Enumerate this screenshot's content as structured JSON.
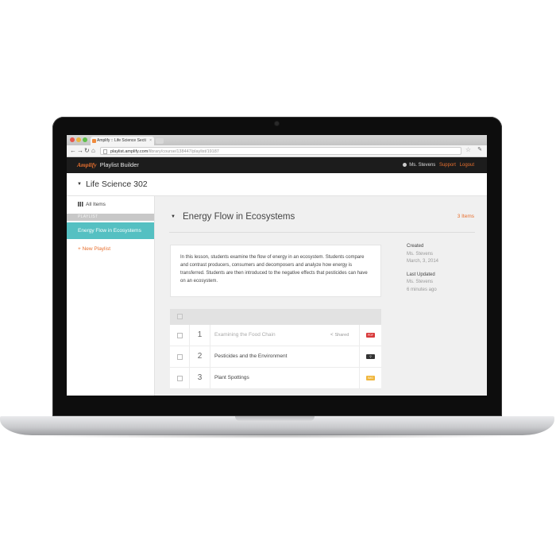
{
  "browser": {
    "tab_title": "Amplify :: Life Science Secti",
    "url_host": "playlist.amplify.com",
    "url_path": "/library/course/138447/playlist/19187"
  },
  "app": {
    "brand": "Amplify",
    "product": "Playlist Builder",
    "user_name": "Ms. Stevens",
    "support_label": "Support",
    "logout_label": "Logout"
  },
  "course": {
    "title": "Life Science 302"
  },
  "sidebar": {
    "all_items_label": "All Items",
    "section_label": "PLAYLIST",
    "active_playlist": "Energy Flow in Ecosystems",
    "new_playlist_label": "+ New Playlist"
  },
  "playlist": {
    "title": "Energy Flow in Ecosystems",
    "item_count": "3 Items",
    "description": "In this lesson, students examine the flow of energy in an ecosystem. Students compare and contrast producers, consumers and decomposers and analyze how energy is transferred. Students are then  introduced to the negative effects that pesticides can have on an ecosystem.",
    "created_label": "Created",
    "created_by": "Ms. Stevens",
    "created_date": "March, 3, 2014",
    "updated_label": "Last Updated",
    "updated_by": "Ms. Stevens",
    "updated_time": "6 minutes ago"
  },
  "items": [
    {
      "num": "1",
      "title": "Examining the Food Chain",
      "shared": "Shared",
      "type": "PDF",
      "dim": true
    },
    {
      "num": "2",
      "title": "Pesticides and the Environment",
      "shared": "",
      "type": "link",
      "dim": false
    },
    {
      "num": "3",
      "title": "Plant Spottings",
      "shared": "",
      "type": "IMG",
      "dim": false
    }
  ],
  "colors": {
    "accent_orange": "#e8702f",
    "active_teal": "#55c0c2",
    "app_header": "#1c1c1c",
    "pdf_red": "#d8393a",
    "img_yellow": "#f0b63c"
  }
}
